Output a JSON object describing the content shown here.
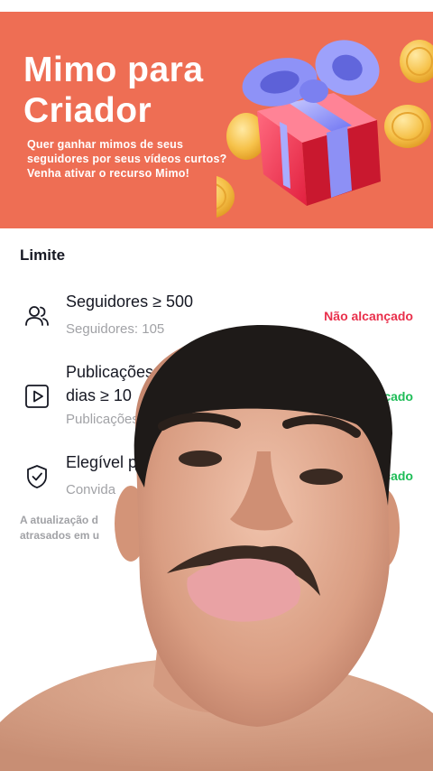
{
  "banner": {
    "title_line1": "Mimo para",
    "title_line2": "Criador",
    "subtitle_line1": "Quer ganhar mimos de seus",
    "subtitle_line2": "seguidores por seus vídeos curtos?",
    "subtitle_line3": "Venha ativar o recurso Mimo!",
    "background_color": "#ee6e54"
  },
  "section": {
    "title": "Limite"
  },
  "requirements": [
    {
      "icon": "followers-icon",
      "title": "Seguidores ≥ 500",
      "meta": "Seguidores: 105",
      "status": "Não alcançado",
      "status_color": "#e9304c"
    },
    {
      "icon": "video-play-icon",
      "title_line1": "Publicações",
      "title_line2": "dias ≥ 10",
      "meta": "Publicações",
      "status": "çado",
      "status_color": "#1fbd58"
    },
    {
      "icon": "shield-check-icon",
      "title": "Elegível p",
      "meta": "Convida",
      "status": "çado",
      "status_color": "#1fbd58"
    }
  ],
  "footnote": {
    "line1": "A atualização d",
    "line2": "atrasados em u"
  }
}
